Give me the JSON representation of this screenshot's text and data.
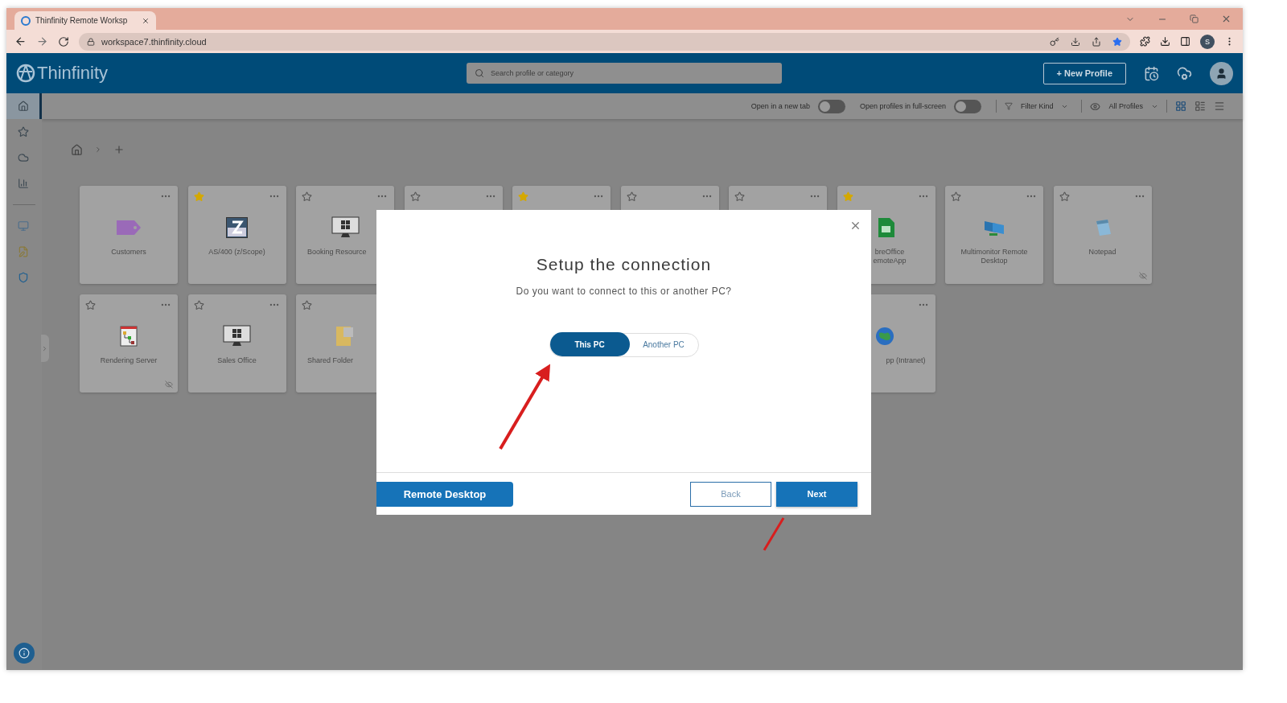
{
  "browser": {
    "tab_title": "Thinfinity Remote Worksp",
    "url": "workspace7.thinfinity.cloud",
    "profile_initial": "S"
  },
  "header": {
    "logo": "Thinfinity",
    "search": {
      "placeholder": "Search profile or category"
    },
    "new_profile": "+ New Profile"
  },
  "sidebar": {
    "items": [
      {
        "kind": "home",
        "selected": true
      },
      {
        "kind": "star",
        "selected": false
      },
      {
        "kind": "cloud",
        "selected": false
      },
      {
        "kind": "chart",
        "selected": false
      },
      {
        "kind": "monitor",
        "selected": false
      },
      {
        "kind": "note",
        "selected": false
      },
      {
        "kind": "shield",
        "selected": false
      }
    ]
  },
  "toolbar": {
    "open_new_tab": {
      "label": "Open in a new tab",
      "on": false
    },
    "full_screen": {
      "label": "Open profiles in full-screen",
      "on": false
    },
    "filter": "Filter Kind",
    "visibility": "All Profiles",
    "views": [
      {
        "kind": "grid",
        "selected": true
      },
      {
        "kind": "tiles",
        "selected": false
      },
      {
        "kind": "list",
        "selected": false
      }
    ]
  },
  "cards": [
    [
      {
        "kind": "tag",
        "label": "Customers"
      },
      {
        "kind": "terminal",
        "label": "AS/400 (z/Scope)",
        "favorite": true
      },
      {
        "kind": "monitor",
        "label": "Booking Resource",
        "favorite": false
      },
      {
        "kind": "blank",
        "favorite": false
      },
      {
        "kind": "blank",
        "favorite": true
      },
      {
        "kind": "blank",
        "favorite": false
      },
      {
        "kind": "blank",
        "favorite": false
      },
      {
        "kind": "spreadsheet",
        "label": "breOffice\nemoteApp",
        "favorite": true
      },
      {
        "kind": "monitors",
        "label": "Multimonitor Remote Desktop",
        "favorite": false
      },
      {
        "kind": "notepad",
        "label": "Notepad",
        "favorite": false,
        "hidden": true
      }
    ],
    [
      {
        "kind": "diagram",
        "label": "Rendering Server",
        "favorite": false,
        "hidden": true
      },
      {
        "kind": "monitor",
        "label": "Sales Office",
        "favorite": false
      },
      {
        "kind": "folder",
        "label": "Shared Folder",
        "favorite": false
      },
      {
        "kind": "empty"
      },
      {
        "kind": "empty"
      },
      {
        "kind": "empty"
      },
      {
        "kind": "empty"
      },
      {
        "kind": "globe",
        "label": "pp (Intranet)"
      }
    ]
  ],
  "modal": {
    "title": "Setup the connection",
    "question": "Do you want to connect to this or another PC?",
    "choices": [
      {
        "label": "This PC",
        "selected": true
      },
      {
        "label": "Another PC",
        "selected": false
      }
    ],
    "badge": "Remote Desktop",
    "buttons": [
      {
        "label": "Back",
        "kind": "secondary"
      },
      {
        "label": "Next",
        "kind": "primary"
      }
    ]
  }
}
